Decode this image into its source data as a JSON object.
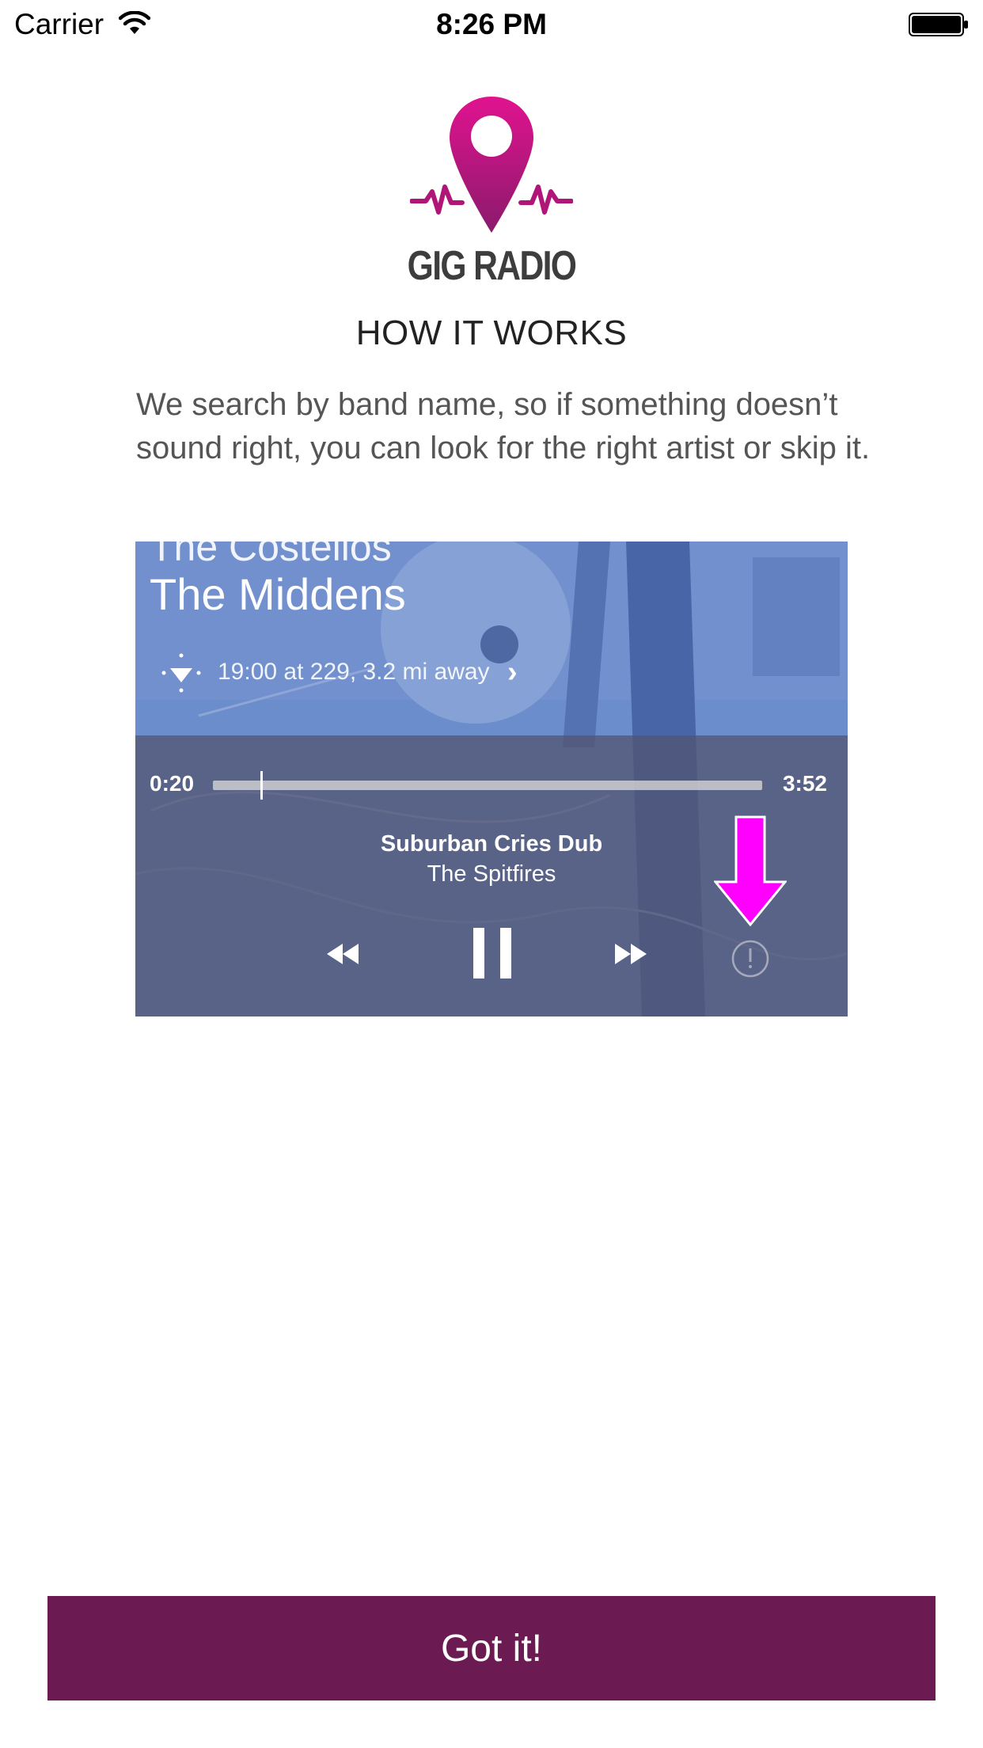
{
  "status_bar": {
    "carrier": "Carrier",
    "time": "8:26 PM",
    "icons": [
      "wifi-icon",
      "battery-icon"
    ]
  },
  "logo": {
    "text": "GIG RADIO",
    "colors": {
      "pin_top": "#e0138f",
      "pin_bottom": "#8b1a6b",
      "text": "#3d3d3d"
    }
  },
  "section_title": "HOW IT WORKS",
  "description": "We search by band name, so if something doesn’t sound right, you can look for the right artist or skip it.",
  "illustration": {
    "previous_band": "The Costellos",
    "band_name": "The Middens",
    "gig_info": "19:00 at 229, 3.2 mi away",
    "player": {
      "time_elapsed": "0:20",
      "time_total": "3:52",
      "progress_fraction": 0.086,
      "song_title": "Suburban Cries Dub",
      "song_artist": "The  Spitfires",
      "controls": [
        "rewind-icon",
        "pause-icon",
        "fast-forward-icon",
        "report-icon"
      ]
    },
    "highlight_arrow_color": "#ff00ff"
  },
  "button": {
    "label": "Got it!",
    "color": "#6b1a52"
  }
}
